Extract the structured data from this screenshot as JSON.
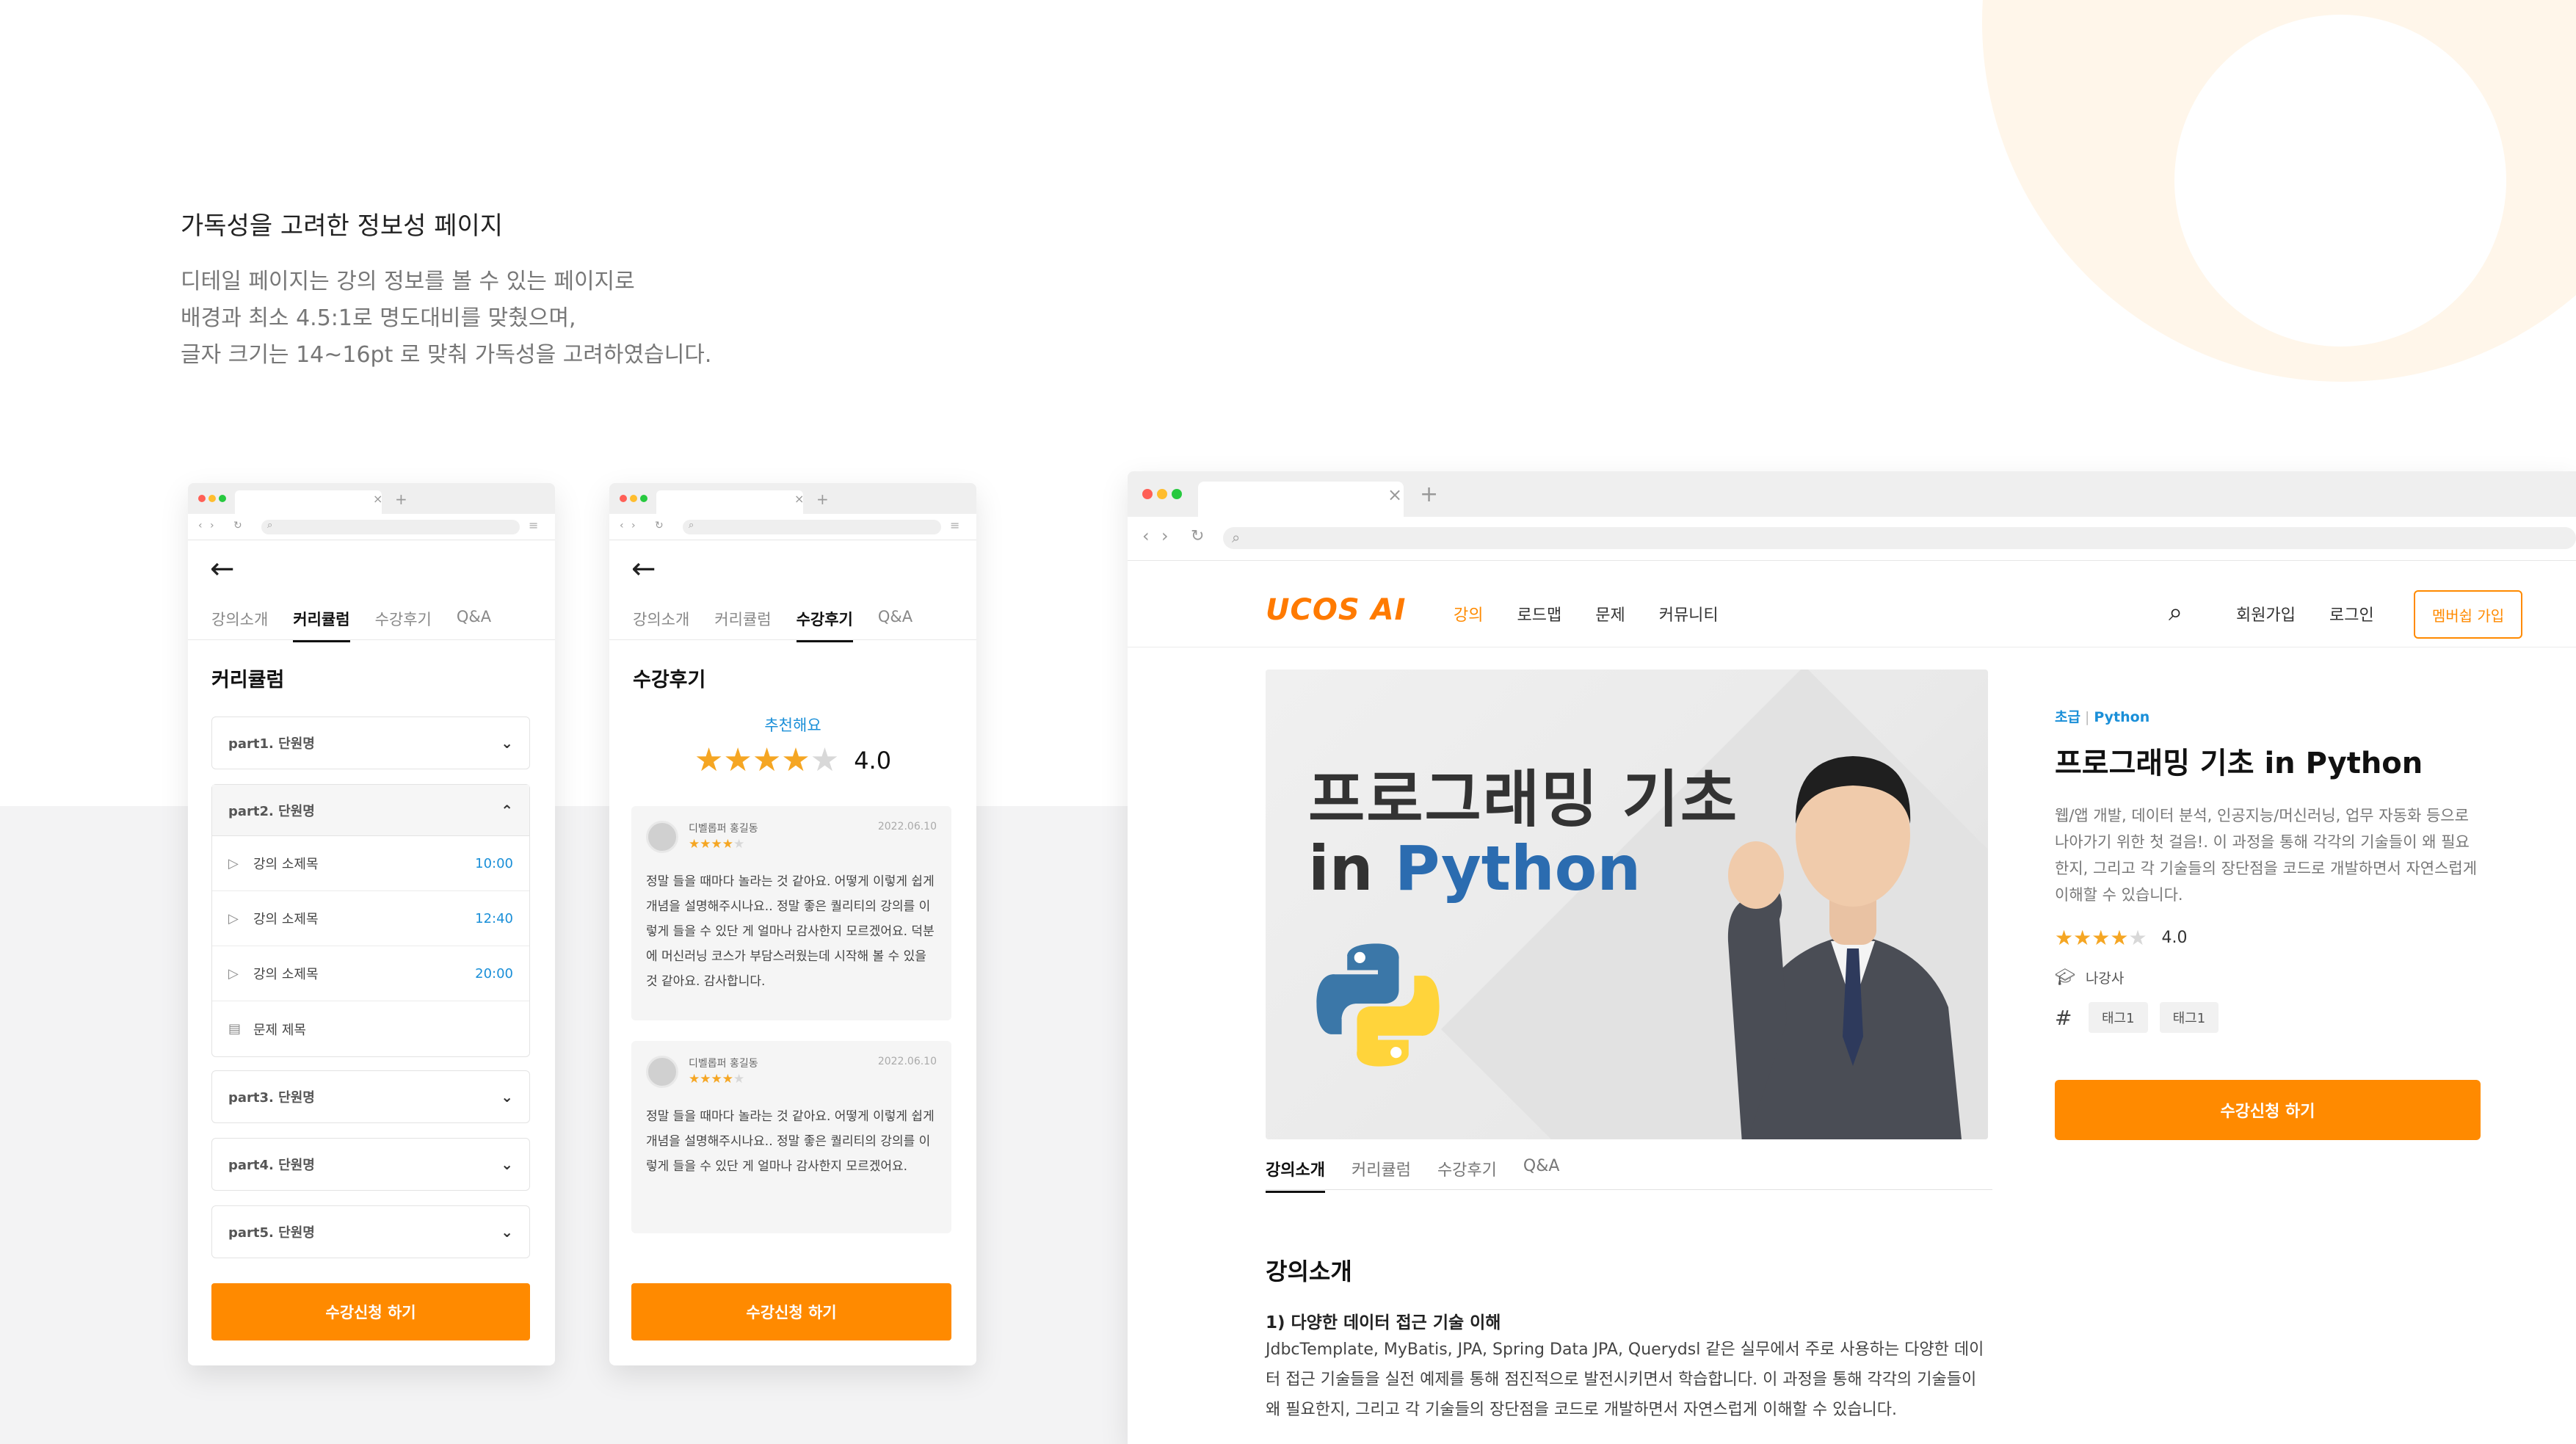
{
  "intro": {
    "title": "가독성을 고려한 정보성 페이지",
    "lines": [
      "디테일 페이지는 강의 정보를 볼 수 있는 페이지로",
      "배경과 최소 4.5:1로 명도대비를 맞췄으며,",
      "글자 크기는 14~16pt 로 맞춰 가독성을 고려하였습니다."
    ]
  },
  "colors": {
    "accent": "#ff8a00",
    "link": "#1a8fd8",
    "star": "#f5a623"
  },
  "browser": {
    "tab_close": "×",
    "tab_add": "+"
  },
  "mobile_tabs": [
    "강의소개",
    "커리큘럼",
    "수강후기",
    "Q&A"
  ],
  "curriculum_screen": {
    "active_tab": "커리큘럼",
    "heading": "커리큘럼",
    "parts": [
      {
        "title": "part1. 단원명",
        "open": false
      },
      {
        "title": "part2. 단원명",
        "open": true,
        "lessons": [
          {
            "icon": "play-icon",
            "name": "강의 소제목",
            "time": "10:00"
          },
          {
            "icon": "play-icon",
            "name": "강의 소제목",
            "time": "12:40"
          },
          {
            "icon": "play-icon",
            "name": "강의 소제목",
            "time": "20:00"
          },
          {
            "icon": "quiz-icon",
            "name": "문제 제목",
            "time": ""
          }
        ]
      },
      {
        "title": "part3. 단원명",
        "open": false
      },
      {
        "title": "part4. 단원명",
        "open": false
      },
      {
        "title": "part5. 단원명",
        "open": false
      }
    ],
    "cta": "수강신청 하기"
  },
  "review_screen": {
    "active_tab": "수강후기",
    "heading": "수강후기",
    "recommend": "추천해요",
    "rating": "4.0",
    "rating_stars": 4,
    "reviews": [
      {
        "author": "디벨롭퍼 홍길동",
        "stars": 4,
        "date": "2022.06.10",
        "text": "정말 들을 때마다 놀라는 것 같아요. 어떻게 이렇게 쉽게 개념을 설명해주시나요.. 정말 좋은 퀄리티의 강의를 이렇게 들을 수 있단 게 얼마나 감사한지 모르겠어요. 덕분에 머신러닝 코스가 부담스러웠는데 시작해 볼 수 있을 것 같아요. 감사합니다."
      },
      {
        "author": "디벨롭퍼 홍길동",
        "stars": 4,
        "date": "2022.06.10",
        "text": "정말 들을 때마다 놀라는 것 같아요. 어떻게 이렇게 쉽게 개념을 설명해주시나요.. 정말 좋은 퀄리티의 강의를 이렇게 들을 수 있단 게 얼마나 감사한지 모르겠어요."
      }
    ],
    "cta": "수강신청 하기"
  },
  "desktop": {
    "logo": "UCOS AI",
    "menu": [
      "강의",
      "로드맵",
      "문제",
      "커뮤니티"
    ],
    "active_menu": "강의",
    "signup": "회원가입",
    "login": "로그인",
    "membership": "멤버쉽 가입",
    "hero": {
      "line1": "프로그래밍 기초",
      "line2_prefix": "in ",
      "line2_accent": "Python"
    },
    "tabs": [
      "강의소개",
      "커리큘럼",
      "수강후기",
      "Q&A"
    ],
    "active_tab": "강의소개",
    "section_title": "강의소개",
    "section_subtitle": "1) 다양한 데이터 접근 기술 이해",
    "section_body": "JdbcTemplate, MyBatis, JPA, Spring Data JPA, Querydsl 같은 실무에서 주로 사용하는 다양한 데이터 접근 기술들을 실전 예제를 통해 점진적으로 발전시키면서 학습합니다. 이 과정을 통해 각각의 기술들이 왜 필요한지, 그리고 각 기술들의 장단점을 코드로 개발하면서 자연스럽게 이해할 수 있습니다.",
    "course": {
      "level": "초급",
      "category": "Python",
      "title": "프로그래밍 기초 in Python",
      "desc": "웹/앱 개발, 데이터 분석, 인공지능/머신러닝, 업무 자동화 등으로 나아가기 위한 첫 걸음!. 이 과정을 통해 각각의 기술들이 왜 필요한지, 그리고 각 기술들의 장단점을 코드로 개발하면서 자연스럽게 이해할 수 있습니다.",
      "rating": "4.0",
      "rating_stars": 4,
      "teacher": "나강사",
      "tags": [
        "태그1",
        "태그1"
      ],
      "cta": "수강신청 하기"
    }
  }
}
